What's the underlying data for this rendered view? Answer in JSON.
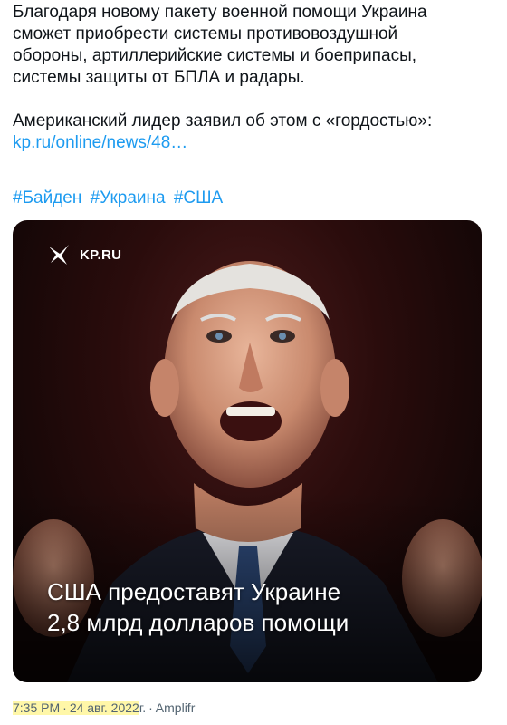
{
  "tweet": {
    "lines": [
      "Благодаря новому пакету военной помощи Украина",
      "сможет приобрести системы противовоздушной",
      "обороны, артиллерийские системы и боеприпасы,",
      "системы защиты от БПЛА и радары."
    ],
    "second_paragraph": "Американский лидер заявил об этом с «гордостью»:",
    "link_text": "kp.ru/online/news/48…",
    "hashtags": [
      "#Байден",
      "#Украина",
      "#США"
    ]
  },
  "media": {
    "brand": "KP.RU",
    "caption_line1": "США предоставят Украине",
    "caption_line2": "2,8 млрд долларов помощи"
  },
  "meta": {
    "time": "7:35 PM",
    "separator": "·",
    "date": "24 авг. 2022",
    "date_suffix": "г.",
    "source": "Amplifr"
  },
  "colors": {
    "link": "#1d9bf0",
    "text": "#0f1419",
    "meta": "#536471",
    "highlight": "#fff7a8"
  }
}
